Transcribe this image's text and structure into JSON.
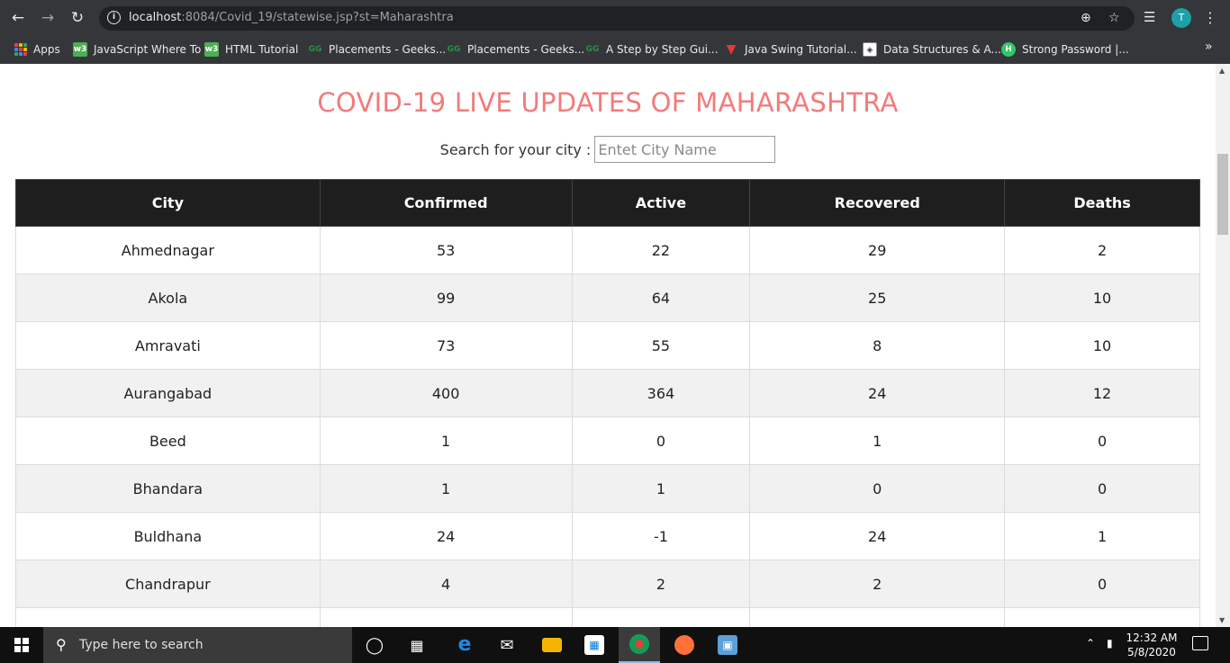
{
  "browser": {
    "url_host": "localhost",
    "url_rest": ":8084/Covid_19/statewise.jsp?st=Maharashtra",
    "profile_initial": "T",
    "bookmarks": [
      {
        "label": "Apps",
        "icon": "apps-grid-icon"
      },
      {
        "label": "JavaScript Where To",
        "icon": "w3schools-icon"
      },
      {
        "label": "HTML Tutorial",
        "icon": "w3schools-icon"
      },
      {
        "label": "Placements - Geeks...",
        "icon": "geeksforgeeks-icon"
      },
      {
        "label": "Placements - Geeks...",
        "icon": "geeksforgeeks-icon"
      },
      {
        "label": "A Step by Step Gui...",
        "icon": "geeksforgeeks-icon"
      },
      {
        "label": "Java Swing Tutorial...",
        "icon": "javatpoint-icon"
      },
      {
        "label": "Data Structures & A...",
        "icon": "hackerearth-icon"
      },
      {
        "label": "Strong Password |...",
        "icon": "hackerrank-icon"
      }
    ]
  },
  "page": {
    "title": "COVID-19 LIVE UPDATES OF MAHARASHTRA",
    "search_label": "Search for your city :",
    "search_placeholder": "Entet City Name",
    "table": {
      "headers": [
        "City",
        "Confirmed",
        "Active",
        "Recovered",
        "Deaths"
      ],
      "rows": [
        [
          "Ahmednagar",
          "53",
          "22",
          "29",
          "2"
        ],
        [
          "Akola",
          "99",
          "64",
          "25",
          "10"
        ],
        [
          "Amravati",
          "73",
          "55",
          "8",
          "10"
        ],
        [
          "Aurangabad",
          "400",
          "364",
          "24",
          "12"
        ],
        [
          "Beed",
          "1",
          "0",
          "1",
          "0"
        ],
        [
          "Bhandara",
          "1",
          "1",
          "0",
          "0"
        ],
        [
          "Buldhana",
          "24",
          "-1",
          "24",
          "1"
        ],
        [
          "Chandrapur",
          "4",
          "2",
          "2",
          "0"
        ],
        [
          "",
          "",
          "",
          "",
          ""
        ]
      ]
    }
  },
  "taskbar": {
    "search_placeholder": "Type here to search",
    "time": "12:32 AM",
    "date": "5/8/2020"
  },
  "colors": {
    "title": "#f27b7b",
    "table_header_bg": "#1e1e1e",
    "row_alt_bg": "#f1f1f1"
  }
}
